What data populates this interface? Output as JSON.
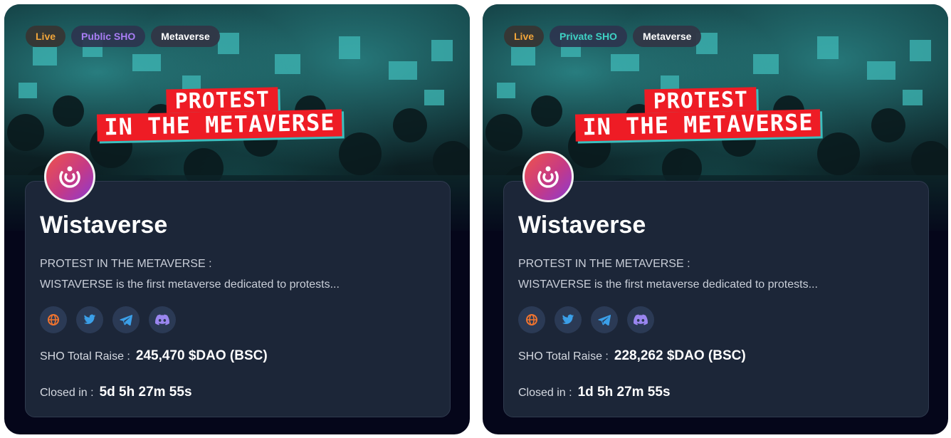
{
  "cards": [
    {
      "tags": {
        "status": "Live",
        "sale_type": "Public SHO",
        "category": "Metaverse"
      },
      "banner": {
        "line1": "PROTEST",
        "line2": "IN THE METAVERSE"
      },
      "project_name": "Wistaverse",
      "description": {
        "line1": "PROTEST IN THE METAVERSE :",
        "line2": "WISTAVERSE is the first metaverse dedicated to protests..."
      },
      "socials": [
        "globe-icon",
        "twitter-icon",
        "telegram-icon",
        "discord-icon"
      ],
      "raise_label": "SHO Total Raise :",
      "raise_value": "245,470 $DAO (BSC)",
      "closed_label": "Closed in :",
      "closed_value": "5d 5h 27m 55s"
    },
    {
      "tags": {
        "status": "Live",
        "sale_type": "Private SHO",
        "category": "Metaverse"
      },
      "banner": {
        "line1": "PROTEST",
        "line2": "IN THE METAVERSE"
      },
      "project_name": "Wistaverse",
      "description": {
        "line1": "PROTEST IN THE METAVERSE :",
        "line2": "WISTAVERSE is the first metaverse dedicated to protests..."
      },
      "socials": [
        "globe-icon",
        "twitter-icon",
        "telegram-icon",
        "discord-icon"
      ],
      "raise_label": "SHO Total Raise :",
      "raise_value": "228,262 $DAO (BSC)",
      "closed_label": "Closed in :",
      "closed_value": "1d 5h 27m 55s"
    }
  ],
  "colors": {
    "card_bg": "#05061a",
    "panel_bg": "#1c2638",
    "live_tag": "#f2a63a",
    "public_tag": "#a97df4",
    "private_tag": "#3ed2c4",
    "banner_red": "#ee1c25",
    "teal": "#3bbfbf"
  }
}
